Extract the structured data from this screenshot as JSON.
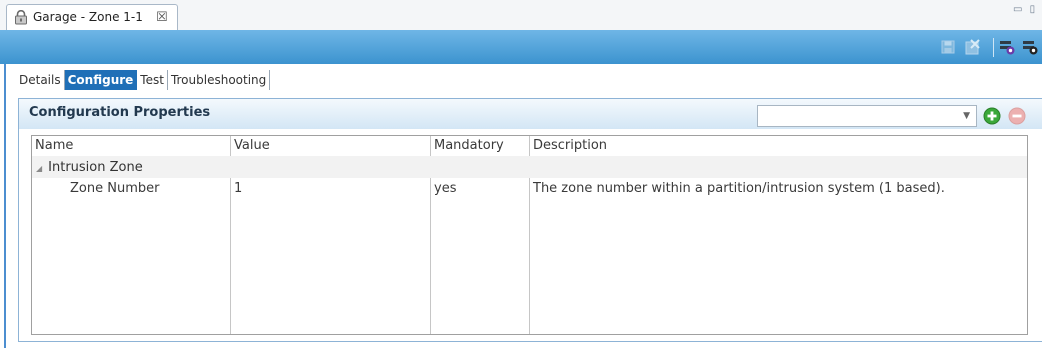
{
  "editor_tab": {
    "title": "Garage - Zone 1-1",
    "close_glyph": "☒",
    "icon": "lock-icon"
  },
  "window_controls": {
    "glyph": "▭ ▯"
  },
  "toolbar": {
    "icons": [
      "save-icon",
      "delete-icon",
      "green-action-icon",
      "dark-action-icon"
    ]
  },
  "subtabs": [
    {
      "label": "Details",
      "active": false
    },
    {
      "label": "Configure",
      "active": true
    },
    {
      "label": "Test",
      "active": false
    },
    {
      "label": "Troubleshooting",
      "active": false
    }
  ],
  "panel": {
    "title": "Configuration Properties",
    "combo_value": "",
    "add_icon": "add-circle-icon",
    "remove_icon": "remove-circle-icon"
  },
  "table": {
    "columns": [
      "Name",
      "Value",
      "Mandatory",
      "Description"
    ],
    "group": {
      "label": "Intrusion Zone"
    },
    "rows": [
      {
        "name": "Zone Number",
        "value": "1",
        "mandatory": "yes",
        "description": "The zone number within a partition/intrusion system (1 based)."
      }
    ]
  },
  "colors": {
    "accent": "#1f6fb7",
    "toolbar_top": "#6fb6e6",
    "toolbar_bottom": "#3c93cf",
    "add": "#3aa83a",
    "remove": "#e8a0a0"
  }
}
